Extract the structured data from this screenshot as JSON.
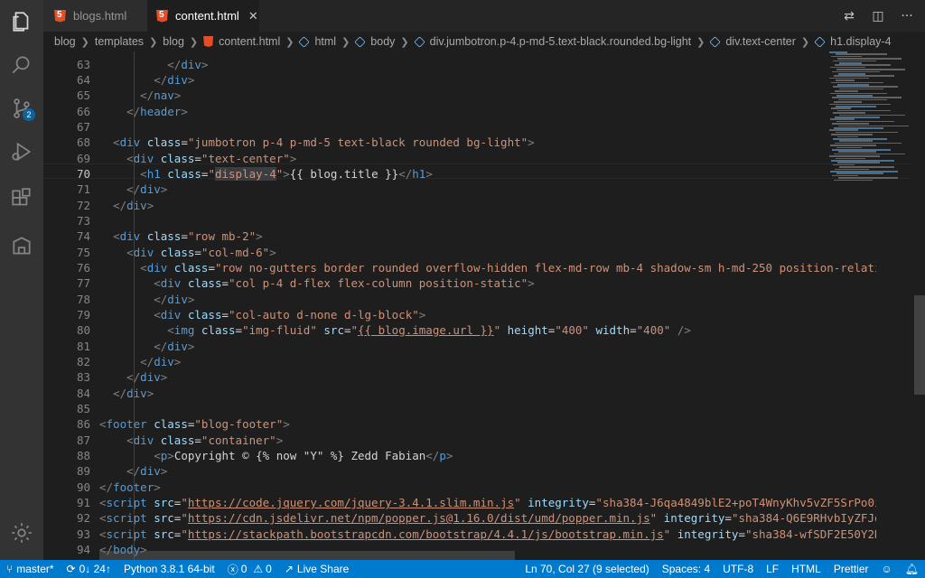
{
  "tabs": [
    {
      "label": "blogs.html",
      "active": false
    },
    {
      "label": "content.html",
      "active": true
    }
  ],
  "breadcrumb": [
    "blog",
    "templates",
    "blog",
    "content.html",
    "html",
    "body",
    "div.jumbotron.p-4.p-md-5.text-black.rounded.bg-light",
    "div.text-center",
    "h1.display-4"
  ],
  "activity_bar": {
    "scm_badge": "2"
  },
  "editor": {
    "current_line": "70",
    "line_numbers": [
      "63",
      "64",
      "65",
      "66",
      "67",
      "68",
      "69",
      "70",
      "71",
      "72",
      "73",
      "74",
      "75",
      "76",
      "77",
      "78",
      "79",
      "80",
      "81",
      "82",
      "83",
      "84",
      "85",
      "86",
      "87",
      "88",
      "89",
      "90",
      "91",
      "92",
      "93",
      "94"
    ]
  },
  "status_bar": {
    "branch": "master*",
    "sync": "0↓ 24↑",
    "python": "Python 3.8.1 64-bit",
    "errors": "0",
    "warnings": "0",
    "live_share": "Live Share",
    "position": "Ln 70, Col 27 (9 selected)",
    "spaces": "Spaces: 4",
    "encoding": "UTF-8",
    "eol": "LF",
    "language": "HTML",
    "formatter": "Prettier"
  },
  "colors": {
    "status_bar": "#007acc",
    "tag": "#569cd6",
    "attribute": "#9cdcfe",
    "string": "#ce9178"
  }
}
